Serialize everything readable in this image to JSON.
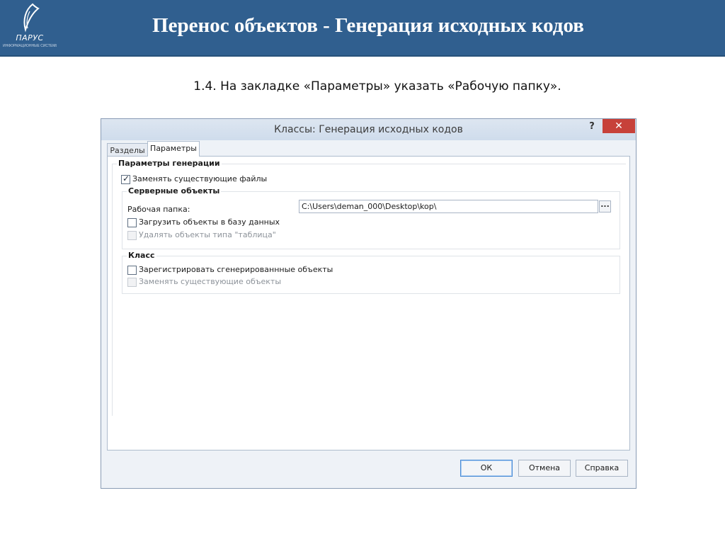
{
  "slide": {
    "title": "Перенос объектов - Генерация исходных кодов",
    "instruction": "1.4. На закладке «Параметры» указать «Рабочую папку».",
    "logo": {
      "name": "ПАРУС",
      "tagline": "ИНФОРМАЦИОННЫЕ СИСТЕМЫ УПРАВЛЕНИЯ"
    },
    "header_color": "#305f8f"
  },
  "dialog": {
    "title": "Классы: Генерация исходных кодов",
    "help_glyph": "?",
    "close_glyph": "✕",
    "close_color": "#c7413a",
    "tabs": [
      {
        "label": "Разделы",
        "active": false
      },
      {
        "label": "Параметры",
        "active": true
      }
    ],
    "generation_group": {
      "title": "Параметры генерации",
      "replace_existing_files": {
        "label": "Заменять существующие файлы",
        "checked": true,
        "enabled": true
      }
    },
    "server_group": {
      "title": "Серверные объекты",
      "work_folder_label": "Рабочая папка:",
      "work_folder_value": "C:\\Users\\deman_000\\Desktop\\kop\\",
      "browse_label": "...",
      "load_to_db": {
        "label": "Загрузить объекты в базу данных",
        "checked": false,
        "enabled": true
      },
      "delete_table_objects": {
        "label": "Удалять объекты типа \"таблица\"",
        "checked": false,
        "enabled": false
      }
    },
    "class_group": {
      "title": "Класс",
      "register_generated": {
        "label": "Зарегистрировать сгенерированнные объекты",
        "checked": false,
        "enabled": true
      },
      "replace_existing_objects": {
        "label": "Заменять существующие объекты",
        "checked": false,
        "enabled": false
      }
    },
    "buttons": {
      "ok": "ОК",
      "cancel": "Отмена",
      "help": "Справка"
    },
    "check_mark": "✓"
  }
}
